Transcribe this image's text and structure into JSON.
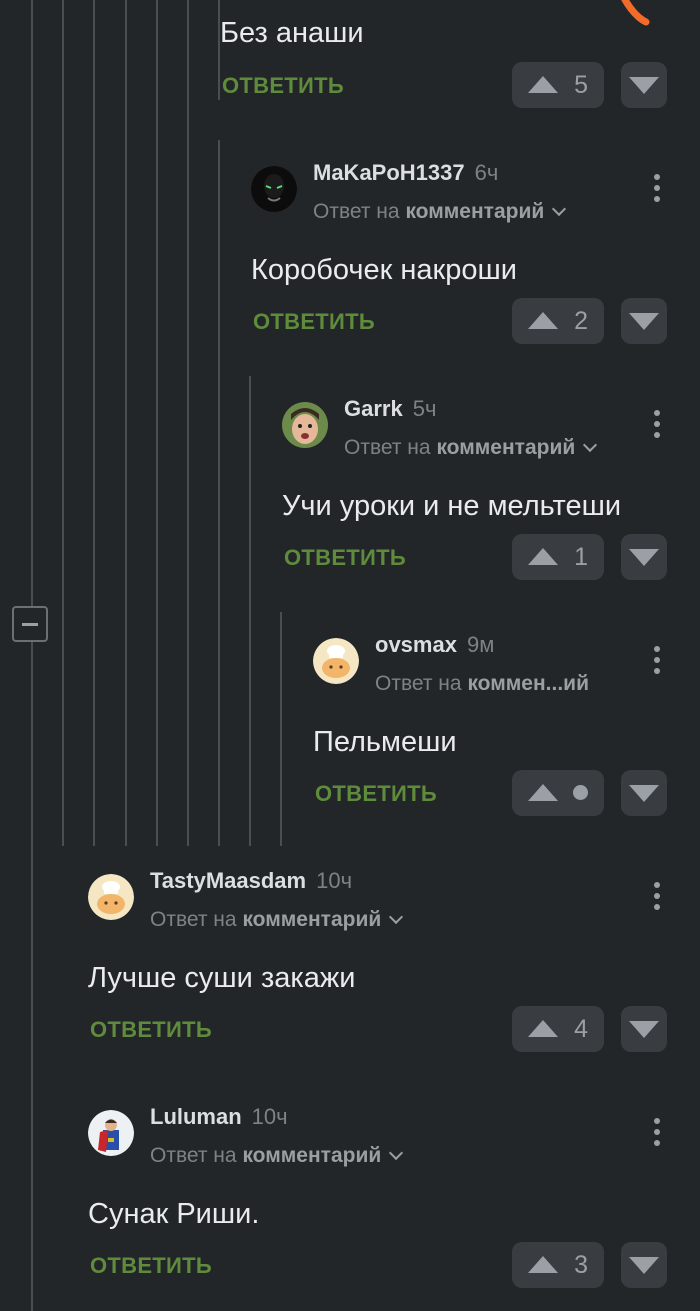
{
  "reply_label": "ОТВЕТИТЬ",
  "reply_prefix": "Ответ на",
  "top_comment": {
    "text": "Без анаши",
    "votes": "5"
  },
  "comments": [
    {
      "user": "MaKaPoH1337",
      "time": "6ч",
      "reply_target": "комментарий",
      "text": "Коробочек накроши",
      "votes": "2"
    },
    {
      "user": "Garrk",
      "time": "5ч",
      "reply_target": "комментарий",
      "text": "Учи уроки и не мельтеши",
      "votes": "1"
    },
    {
      "user": "ovsmax",
      "time": "9м",
      "reply_target": "коммен...ий",
      "text": "Пельмеши",
      "votes": ""
    },
    {
      "user": "TastyMaasdam",
      "time": "10ч",
      "reply_target": "комментарий",
      "text": "Лучше суши закажи",
      "votes": "4"
    },
    {
      "user": "Luluman",
      "time": "10ч",
      "reply_target": "комментарий",
      "text": "Сунак Риши.",
      "votes": "3"
    }
  ],
  "colors": {
    "background": "#232629",
    "accent_green": "#5f8b3c",
    "button_bg": "#393d41",
    "thread_line": "#4a4e52",
    "orange_mark": "#f26b2a"
  }
}
